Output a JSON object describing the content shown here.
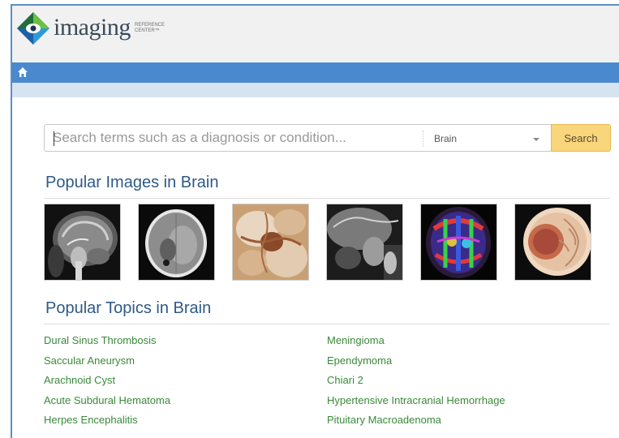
{
  "header": {
    "logo_text": "imaging",
    "logo_subtext": "REFERENCE CENTER™"
  },
  "nav": {
    "home_icon": "home-icon"
  },
  "search": {
    "placeholder": "Search terms such as a diagnosis or condition...",
    "category": "Brain",
    "button_label": "Search"
  },
  "popular_images": {
    "title": "Popular Images in Brain",
    "images": [
      {
        "name": "sagittal-mri-brain"
      },
      {
        "name": "axial-ct-brain"
      },
      {
        "name": "gross-pathology-brain"
      },
      {
        "name": "sagittal-mri-pituitary"
      },
      {
        "name": "dti-tractography-color"
      },
      {
        "name": "illustration-meningioma"
      }
    ]
  },
  "popular_topics": {
    "title": "Popular Topics in Brain",
    "left": [
      "Dural Sinus Thrombosis",
      "Saccular Aneurysm",
      "Arachnoid Cyst",
      "Acute Subdural Hematoma",
      "Herpes Encephalitis"
    ],
    "right": [
      "Meningioma",
      "Ependymoma",
      "Chiari 2",
      "Hypertensive Intracranial Hemorrhage",
      "Pituitary Macroadenoma"
    ]
  },
  "colors": {
    "nav_blue": "#4a89cd",
    "link_green": "#3a8a3a",
    "title_blue": "#2f5a86",
    "search_button": "#f9d57c"
  }
}
